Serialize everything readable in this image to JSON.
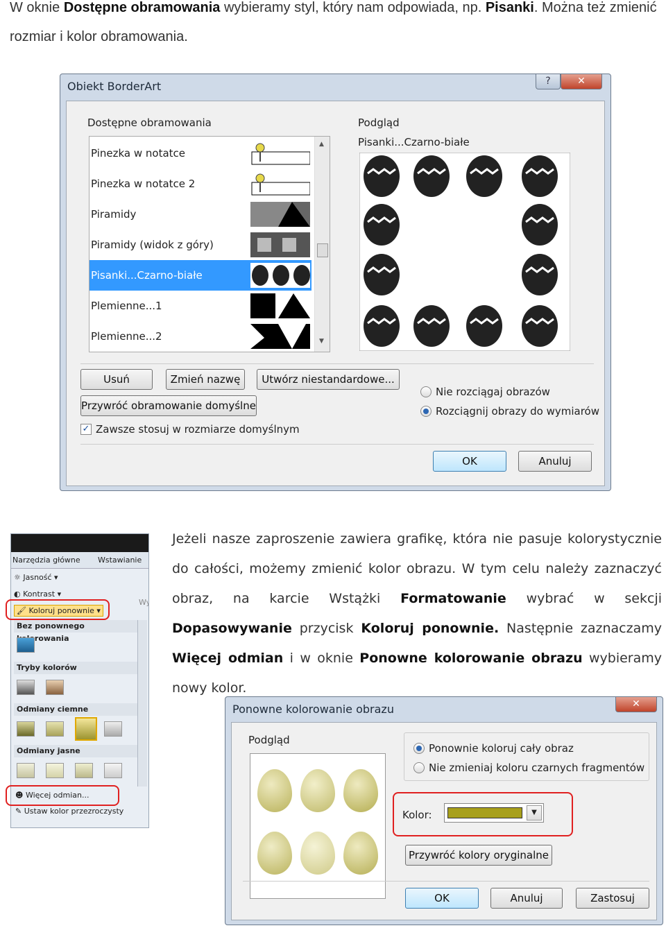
{
  "intro": {
    "part1": "W oknie ",
    "bold1": "Dostępne obramowania",
    "part2": " wybieramy styl, który nam odpowiada, np. ",
    "bold2": "Pisanki",
    "part3": ". Można też zmienić rozmiar i kolor obramowania."
  },
  "borderart": {
    "title": "Obiekt BorderArt",
    "help_label": "?",
    "close_label": "✕",
    "available_label": "Dostępne obramowania",
    "preview_label": "Podgląd",
    "preview_name": "Pisanki...Czarno-białe",
    "items": [
      {
        "label": "Pinezka w notatce"
      },
      {
        "label": "Pinezka w notatce 2"
      },
      {
        "label": "Piramidy"
      },
      {
        "label": "Piramidy (widok z góry)"
      },
      {
        "label": "Pisanki...Czarno-białe"
      },
      {
        "label": "Plemienne...1"
      },
      {
        "label": "Plemienne...2"
      }
    ],
    "delete_btn": "Usuń",
    "rename_btn": "Zmień nazwę",
    "custom_btn": "Utwórz niestandardowe...",
    "restore_btn": "Przywróć obramowanie domyślne",
    "always_default": "Zawsze stosuj w rozmiarze domyślnym",
    "radio_no_stretch": "Nie rozciągaj obrazów",
    "radio_stretch": "Rozciągnij obrazy do wymiarów",
    "ok_btn": "OK",
    "cancel_btn": "Anuluj"
  },
  "para2": {
    "t1": "Jeżeli nasze zaproszenie zawiera grafikę, która nie pasuje kolorystycznie do całości, możemy zmienić kolor obrazu. W tym celu należy zaznaczyć obraz, na karcie Wstążki ",
    "b1": "Formatowanie",
    "t2": " wybrać w sekcji ",
    "b2": "Dopasowywanie",
    "t3": " przycisk ",
    "b3": "Koloruj ponownie.",
    "t4": " Następnie zaznaczamy ",
    "b4": "Więcej odmian",
    "t5": " i w oknie ",
    "b5": "Ponowne kolorowanie obrazu",
    "t6": " wybieramy nowy kolor."
  },
  "ribbon": {
    "tab_home": "Narzędzia główne",
    "tab_insert": "Wstawianie",
    "brightness": "Jasność",
    "contrast": "Kontrast",
    "recolor": "Koloruj ponownie",
    "wy_label": "Wy",
    "no_recolor": "Bez ponownego kolorowania",
    "color_modes": "Tryby kolorów",
    "dark_variants": "Odmiany ciemne",
    "light_variants": "Odmiany jasne",
    "more_variants": "Więcej odmian...",
    "set_transparent": "Ustaw kolor przezroczysty"
  },
  "recolor_dialog": {
    "title": "Ponowne kolorowanie obrazu",
    "close_label": "✕",
    "preview_label": "Podgląd",
    "radio_whole": "Ponownie koloruj cały obraz",
    "radio_keep_black": "Nie zmieniaj koloru czarnych fragmentów",
    "color_label": "Kolor:",
    "color_value": "#a8a01c",
    "restore_btn": "Przywróć kolory oryginalne",
    "ok_btn": "OK",
    "cancel_btn": "Anuluj",
    "apply_btn": "Zastosuj"
  }
}
